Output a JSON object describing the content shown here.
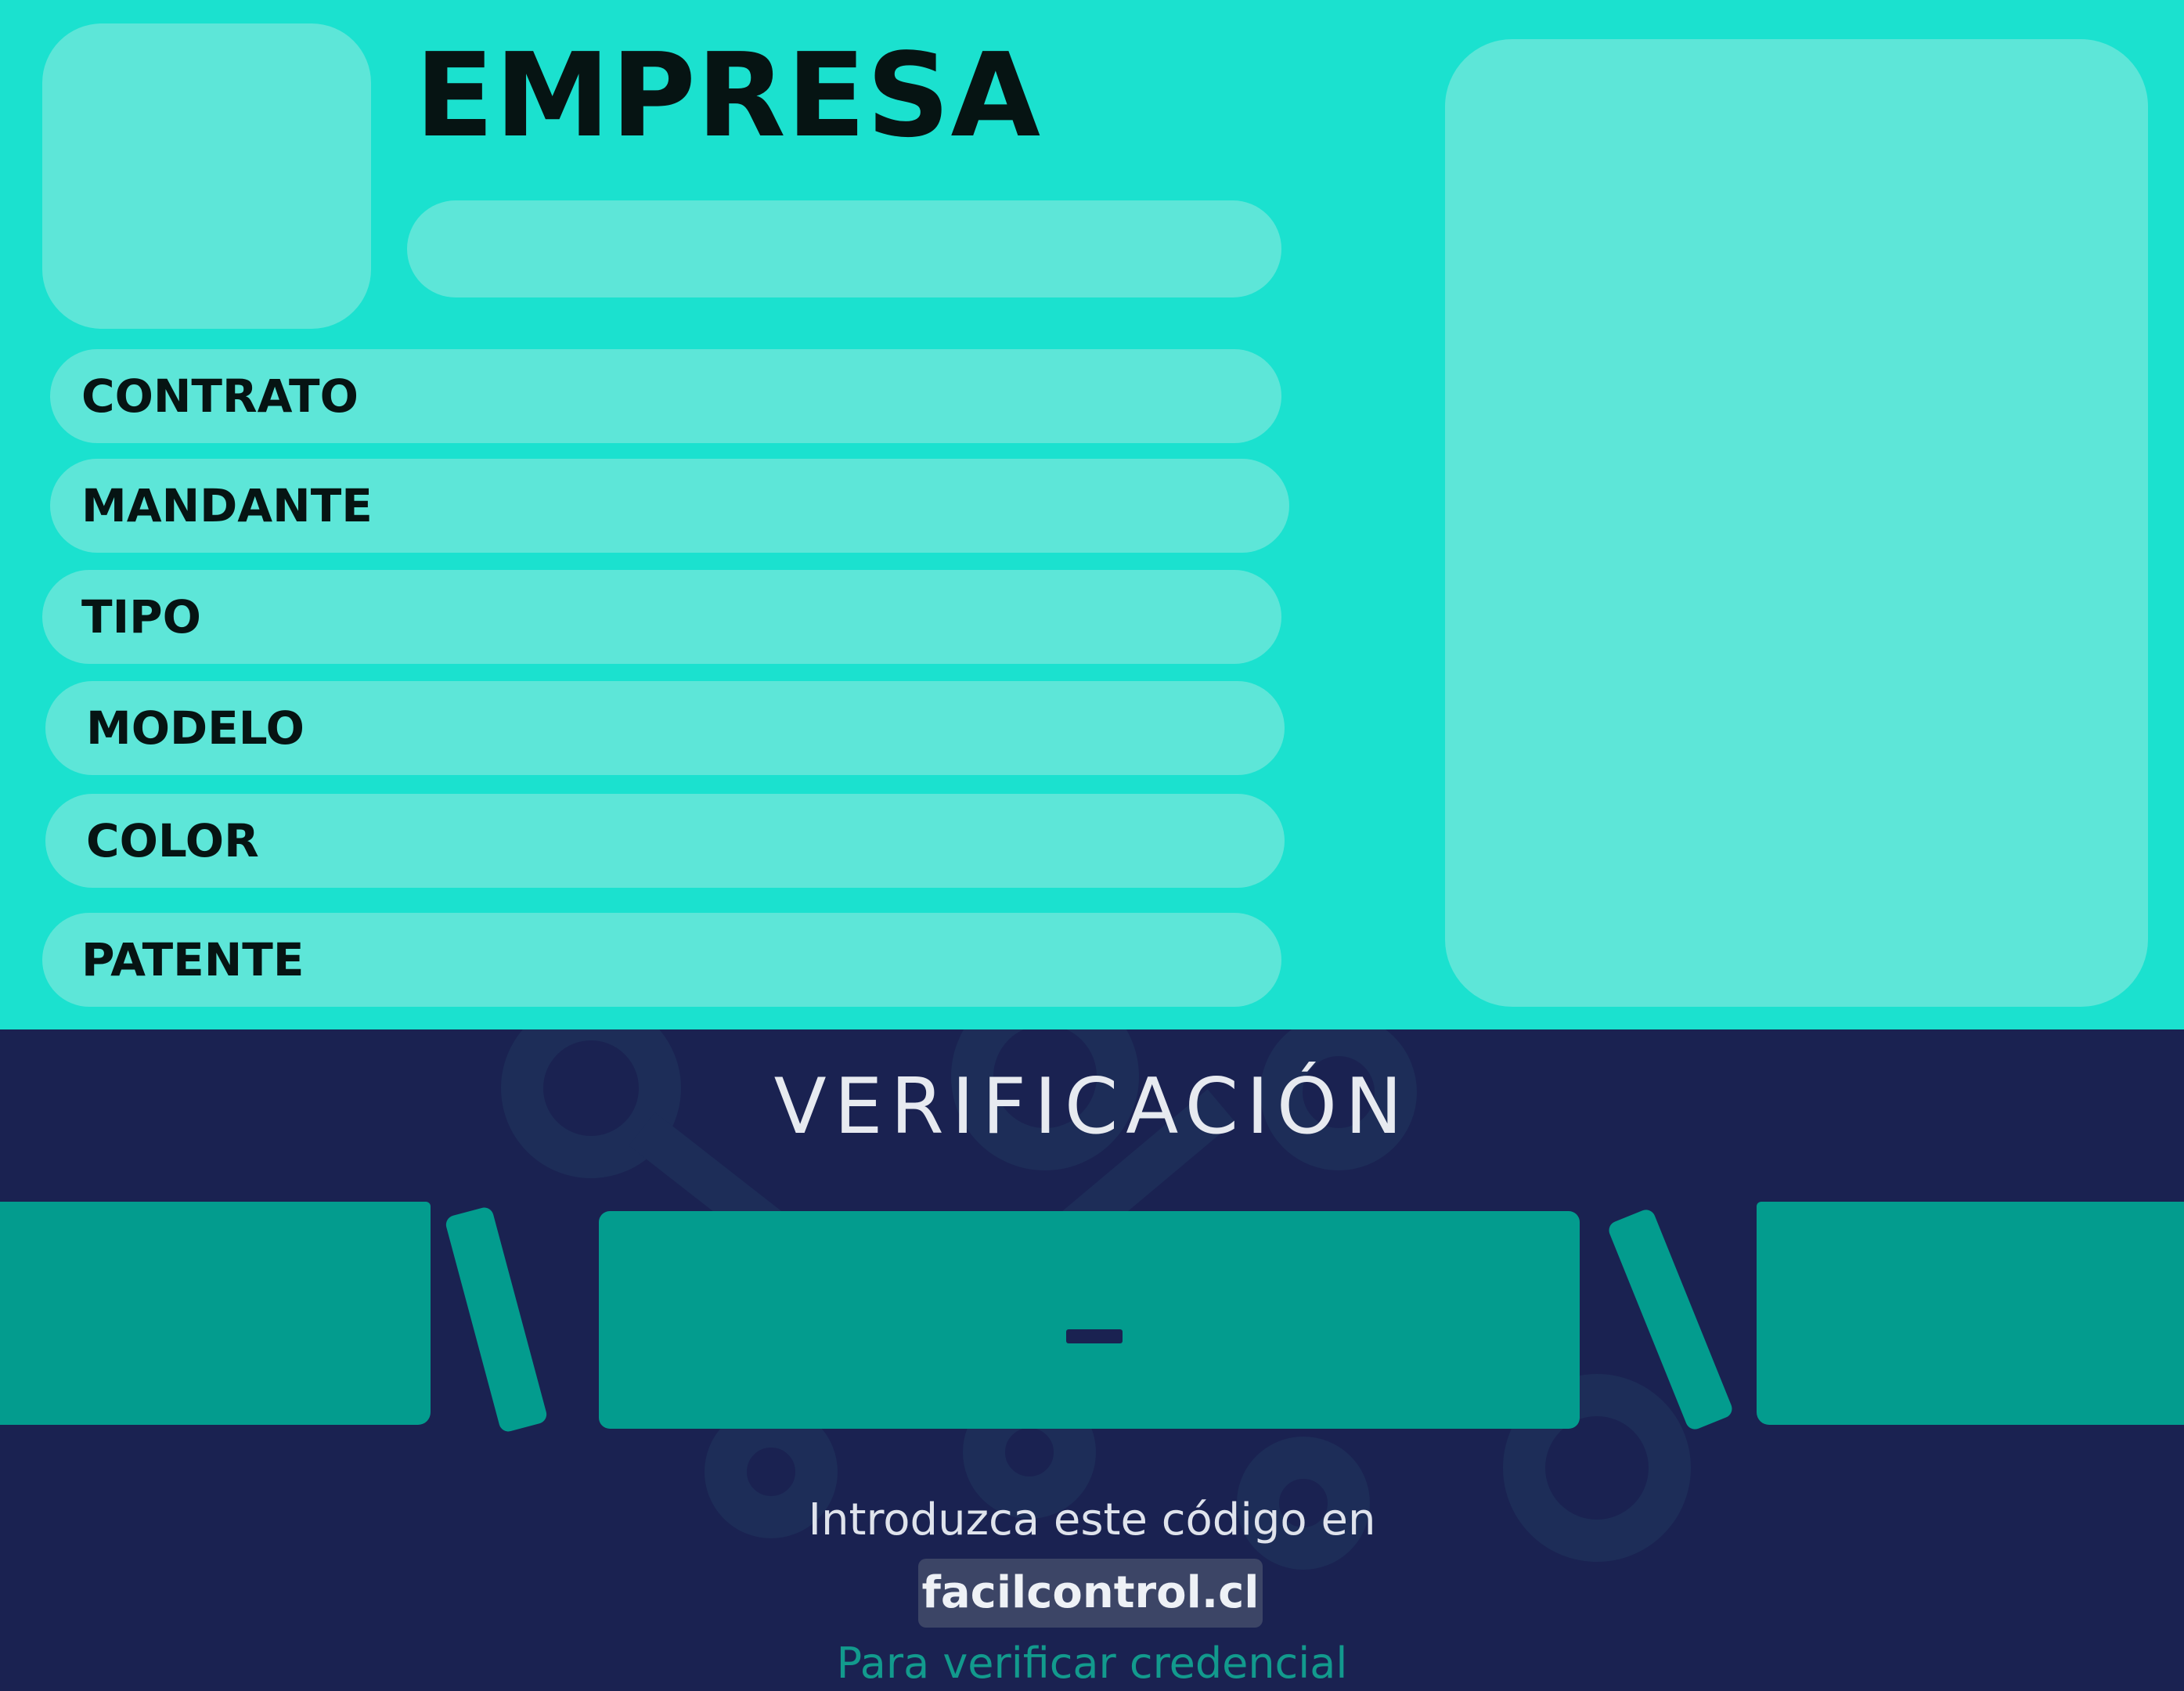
{
  "header": {
    "title": "EMPRESA",
    "subtitle": ""
  },
  "fields": [
    {
      "label": "CONTRATO",
      "value": ""
    },
    {
      "label": "MANDANTE",
      "value": ""
    },
    {
      "label": "TIPO",
      "value": ""
    },
    {
      "label": "MODELO",
      "value": ""
    },
    {
      "label": "COLOR",
      "value": ""
    },
    {
      "label": "PATENTE",
      "value": ""
    }
  ],
  "verification": {
    "title": "VERIFICACIÓN",
    "code": "",
    "instruction": "Introduzca este código en",
    "site": "facilcontrol.cl",
    "note": "Para verificar credencial"
  },
  "colors": {
    "top_background": "#1be1cf",
    "panel": "#5de6d8",
    "bottom_background": "#1a2251",
    "code_teal": "#039c8e",
    "note_text": "#129a8d"
  },
  "icons": [
    "logo-placeholder",
    "photo-placeholder",
    "gear-network-watermark"
  ]
}
